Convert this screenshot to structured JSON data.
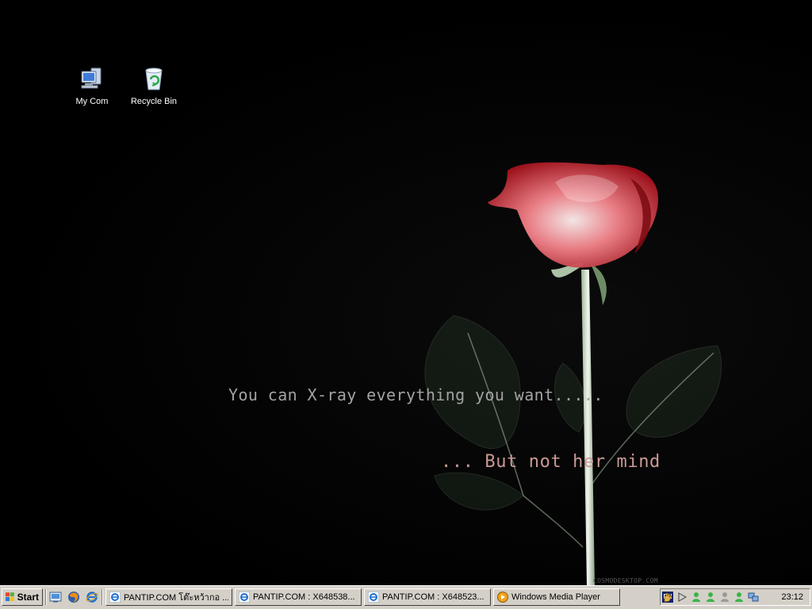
{
  "desktop": {
    "icons": [
      {
        "label": "My Com"
      },
      {
        "label": "Recycle Bin"
      }
    ],
    "wallpaper": {
      "line1": "You can X-ray everything you want.....",
      "line2": "... But not  her mind",
      "credit": "COSMODESKTOP.COM"
    }
  },
  "taskbar": {
    "start_label": "Start",
    "quick_launch": [
      "show-desktop-icon",
      "firefox-icon",
      "internet-explorer-icon"
    ],
    "tasks": [
      {
        "label": "PANTIP.COM โต๊ะหว้ากอ ...",
        "icon": "internet-explorer-icon"
      },
      {
        "label": "PANTIP.COM : X648538...",
        "icon": "internet-explorer-icon"
      },
      {
        "label": "PANTIP.COM : X648523...",
        "icon": "internet-explorer-icon"
      },
      {
        "label": "Windows Media Player",
        "icon": "media-player-icon"
      }
    ],
    "tray": {
      "language": "EN",
      "icons": [
        "hand-icon",
        "play-icon",
        "messenger-icon",
        "messenger-icon",
        "messenger-offline-icon",
        "messenger-icon",
        "network-icon"
      ],
      "clock": "23:12"
    }
  },
  "colors": {
    "taskbar_bg": "#d4d0c8",
    "desktop_bg": "#000000",
    "rose": "#e8505a"
  }
}
